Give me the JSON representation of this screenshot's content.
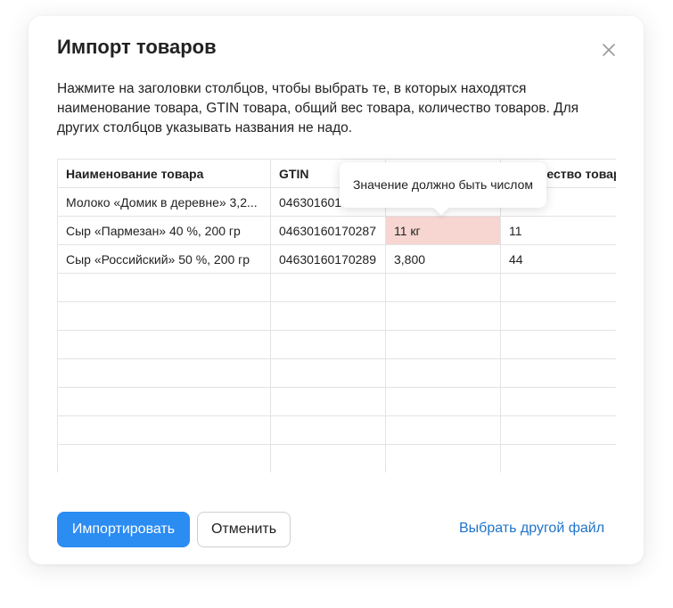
{
  "dialog": {
    "title": "Импорт товаров",
    "description": "Нажмите на заголовки столбцов, чтобы выбрать те, в которых находятся наименование товара, GTIN товара, общий вес товара, количество товаров. Для других столбцов указывать названия не надо.",
    "close_icon": "close-icon"
  },
  "table": {
    "headers": [
      "Наименование товара",
      "GTIN",
      "",
      "Количество товаров"
    ],
    "rows": [
      [
        "Молоко «Домик в деревне» 3,2...",
        "04630160170287",
        "",
        ""
      ],
      [
        "Сыр «Пармезан» 40 %, 200 гр",
        "04630160170287",
        "11 кг",
        "11"
      ],
      [
        "Сыр «Российский» 50 %, 200 гр",
        "04630160170289",
        "3,800",
        "44"
      ]
    ],
    "error_cell": "11 кг",
    "error_color": "#f7d6d2"
  },
  "tooltip": {
    "text": "Значение должно быть числом"
  },
  "buttons": {
    "import_label": "Импортировать",
    "cancel_label": "Отменить",
    "choose_file_label": "Выбрать другой файл"
  },
  "colors": {
    "primary": "#2b8cf2",
    "link": "#1f74c9"
  }
}
